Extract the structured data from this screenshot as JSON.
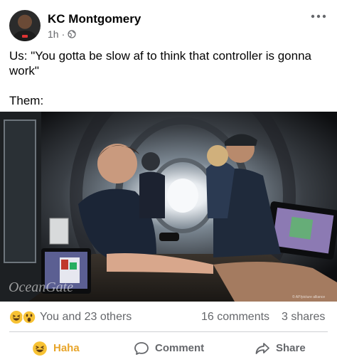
{
  "post": {
    "author": "KC Montgomery",
    "time": "1h",
    "time_sep": "·",
    "caption": "Us: \"You gotta be slow af to think that controller is gonna work\"\n\nThem:"
  },
  "image": {
    "watermark": "OceanGate",
    "credit": "© AP/picture alliance"
  },
  "stats": {
    "reactions_label": "You and 23 others",
    "comments": "16 comments",
    "shares": "3 shares"
  },
  "actions": {
    "haha_label": "Haha",
    "comment_label": "Comment",
    "share_label": "Share"
  },
  "colors": {
    "haha": "#e8a52a",
    "secondary_text": "#65676b",
    "divider": "#ced0d4"
  },
  "icons": [
    "globe-icon",
    "more-icon",
    "haha-emoji-icon",
    "wow-emoji-icon",
    "comment-icon",
    "share-icon"
  ]
}
